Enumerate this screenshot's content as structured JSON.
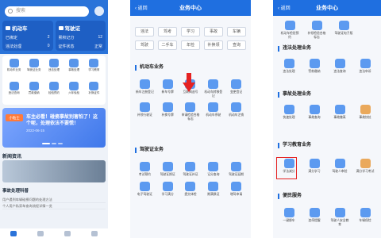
{
  "p1": {
    "search_placeholder": "搜索",
    "vehicle_cards": [
      {
        "title": "机动车",
        "rows": [
          [
            "已绑定",
            "2"
          ],
          [
            "违法处理",
            "0"
          ]
        ]
      },
      {
        "title": "驾驶证",
        "rows": [
          [
            "累积记分",
            "12"
          ],
          [
            "证件状态",
            "正常"
          ]
        ]
      }
    ],
    "services": [
      "机动车业务",
      "驾驶证业务",
      "违法处理",
      "事故处理",
      "学习教育",
      "违法查询",
      "罚款缴纳",
      "检验预约",
      "六年免检",
      "补换证件"
    ],
    "banner": {
      "tag": "小贴士",
      "headline": "车主必看！碰瓷事故别害怕了！这个呢，处理依法不要慌！",
      "date": "2022-06-15"
    },
    "news_section": "新闻资讯",
    "news_title": "事故处理科普",
    "news_items": [
      "用户遇到车辆碰擦问题的处理方法",
      "个人用户私家车查询流程详情一览"
    ]
  },
  "p2": {
    "back": "返回",
    "title": "业务中心",
    "chips": [
      "违法",
      "驾考",
      "学习",
      "事故",
      "车辆",
      "驾驶",
      "二手车",
      "年检",
      "补换领",
      "查询"
    ],
    "sec_vehicle": "机动车业务",
    "vehicle_services": [
      "新车注册登记",
      "新车号牌",
      "互联网选号",
      "机动车转移登记",
      "变更登记",
      "补领行驶证",
      "补换号牌",
      "申请检验合格标志",
      "机动车停驶",
      "机动车注销"
    ],
    "sec_license": "驾驶证业务",
    "license_services": [
      "考试预约",
      "驾驶证换证",
      "驾驶证补证",
      "记分查询",
      "驾驶证延期",
      "电子驾驶证",
      "学习满分",
      "提交体检",
      "期满换证",
      "增驾申请"
    ]
  },
  "p3": {
    "back": "返回",
    "title": "业务中心",
    "top_services": [
      "机动车检验预约",
      "补领检验合格标志",
      "驾驶证电子版"
    ],
    "sec_violation": "违法处理业务",
    "violation_services": [
      "违法处理",
      "罚款缴纳",
      "违法查询",
      "违法申诉"
    ],
    "sec_accident": "事故处理业务",
    "accident_services": [
      "快速处理",
      "事故查询",
      "事故撤离",
      "事故快处"
    ],
    "sec_study": "学习教育业务",
    "study_services": [
      "学法减分",
      "满分学习",
      "驾驶人审验",
      "满分学习考试"
    ],
    "sec_convenience": "便民服务",
    "convenience_services": [
      "一键挪车",
      "违停提醒",
      "驾驶人安全教育",
      "车辆保险"
    ]
  }
}
